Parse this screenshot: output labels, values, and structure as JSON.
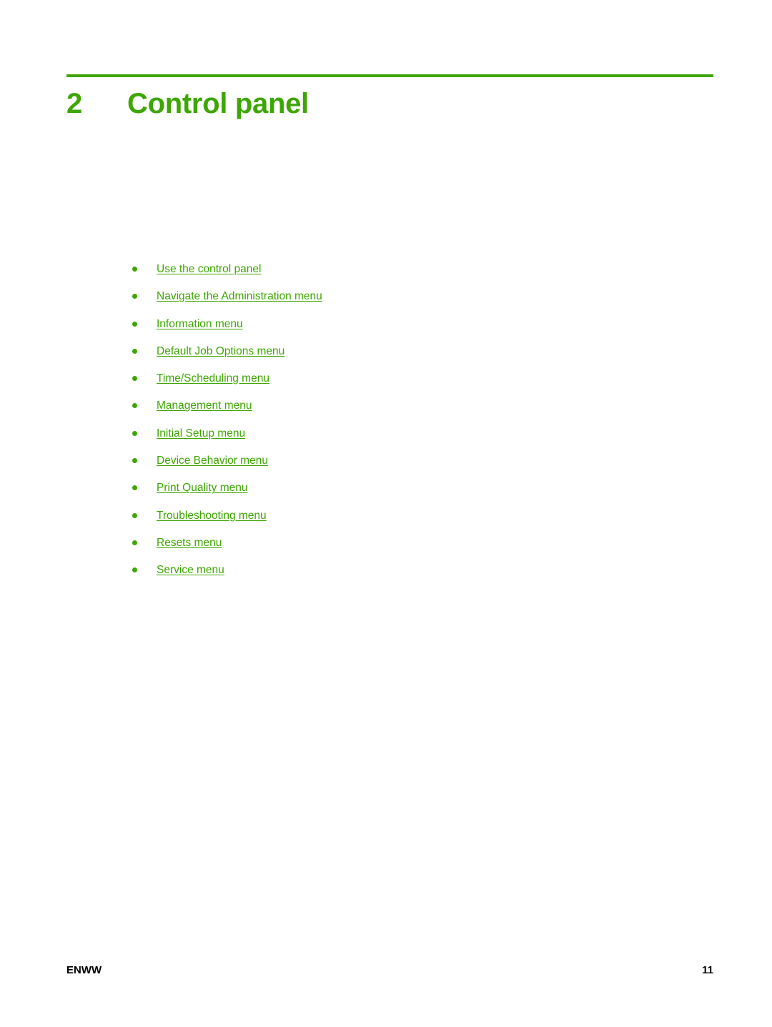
{
  "document": {
    "background_color": "#ffffff",
    "accent_color": "#3da600",
    "text_color": "#000000"
  },
  "chapter": {
    "number": "2",
    "title": "Control panel"
  },
  "toc": {
    "bullet_icon": "bullet-dot-icon",
    "items": [
      {
        "label": "Use the control panel"
      },
      {
        "label": "Navigate the Administration menu"
      },
      {
        "label": "Information menu"
      },
      {
        "label": "Default Job Options menu"
      },
      {
        "label": "Time/Scheduling menu"
      },
      {
        "label": "Management menu"
      },
      {
        "label": "Initial Setup menu"
      },
      {
        "label": "Device Behavior menu"
      },
      {
        "label": "Print Quality menu"
      },
      {
        "label": "Troubleshooting menu"
      },
      {
        "label": "Resets menu"
      },
      {
        "label": "Service menu"
      }
    ]
  },
  "footer": {
    "left": "ENWW",
    "page_number": "11"
  }
}
